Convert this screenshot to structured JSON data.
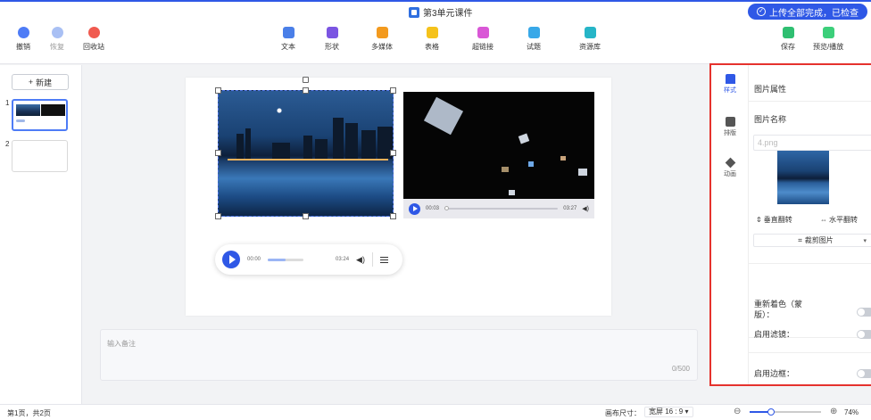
{
  "titlebar": {
    "title": "第3单元课件",
    "upload_status": "上传全部完成，已检查"
  },
  "toolbar": {
    "undo": "撤销",
    "redo": "恢复",
    "recycle": "回收站",
    "text": "文本",
    "shape": "形状",
    "media": "多媒体",
    "table": "表格",
    "hyperlink": "超链接",
    "quiz": "试题",
    "resources": "资源库",
    "save": "保存",
    "preview": "预览/播放"
  },
  "slides_panel": {
    "new_label": "新建",
    "slide_numbers": [
      "1",
      "2"
    ]
  },
  "slide": {
    "video": {
      "current": "00:03",
      "duration": "03:27"
    },
    "audio": {
      "current": "00:00",
      "duration": "03:24"
    }
  },
  "notes": {
    "placeholder": "输入备注",
    "counter": "0/500"
  },
  "side_tabs": {
    "style": "样式",
    "arrange": "排版",
    "animation": "动画"
  },
  "properties": {
    "section_title": "图片属性",
    "name_label": "图片名称",
    "name_value": "4.png",
    "flip_vertical": "垂直翻转",
    "flip_horizontal": "水平翻转",
    "crop": "裁剪图片",
    "recolor": "重新着色（蒙版）：",
    "filter": "启用滤镜：",
    "border": "启用边框："
  },
  "statusbar": {
    "pages": "第1页，共2页",
    "canvas_size_label": "画布尺寸：",
    "canvas_size_value": "宽屏 16 : 9",
    "zoom": "74%"
  },
  "colors": {
    "accent": "#2f58e6",
    "highlight_border": "#e5322d"
  }
}
